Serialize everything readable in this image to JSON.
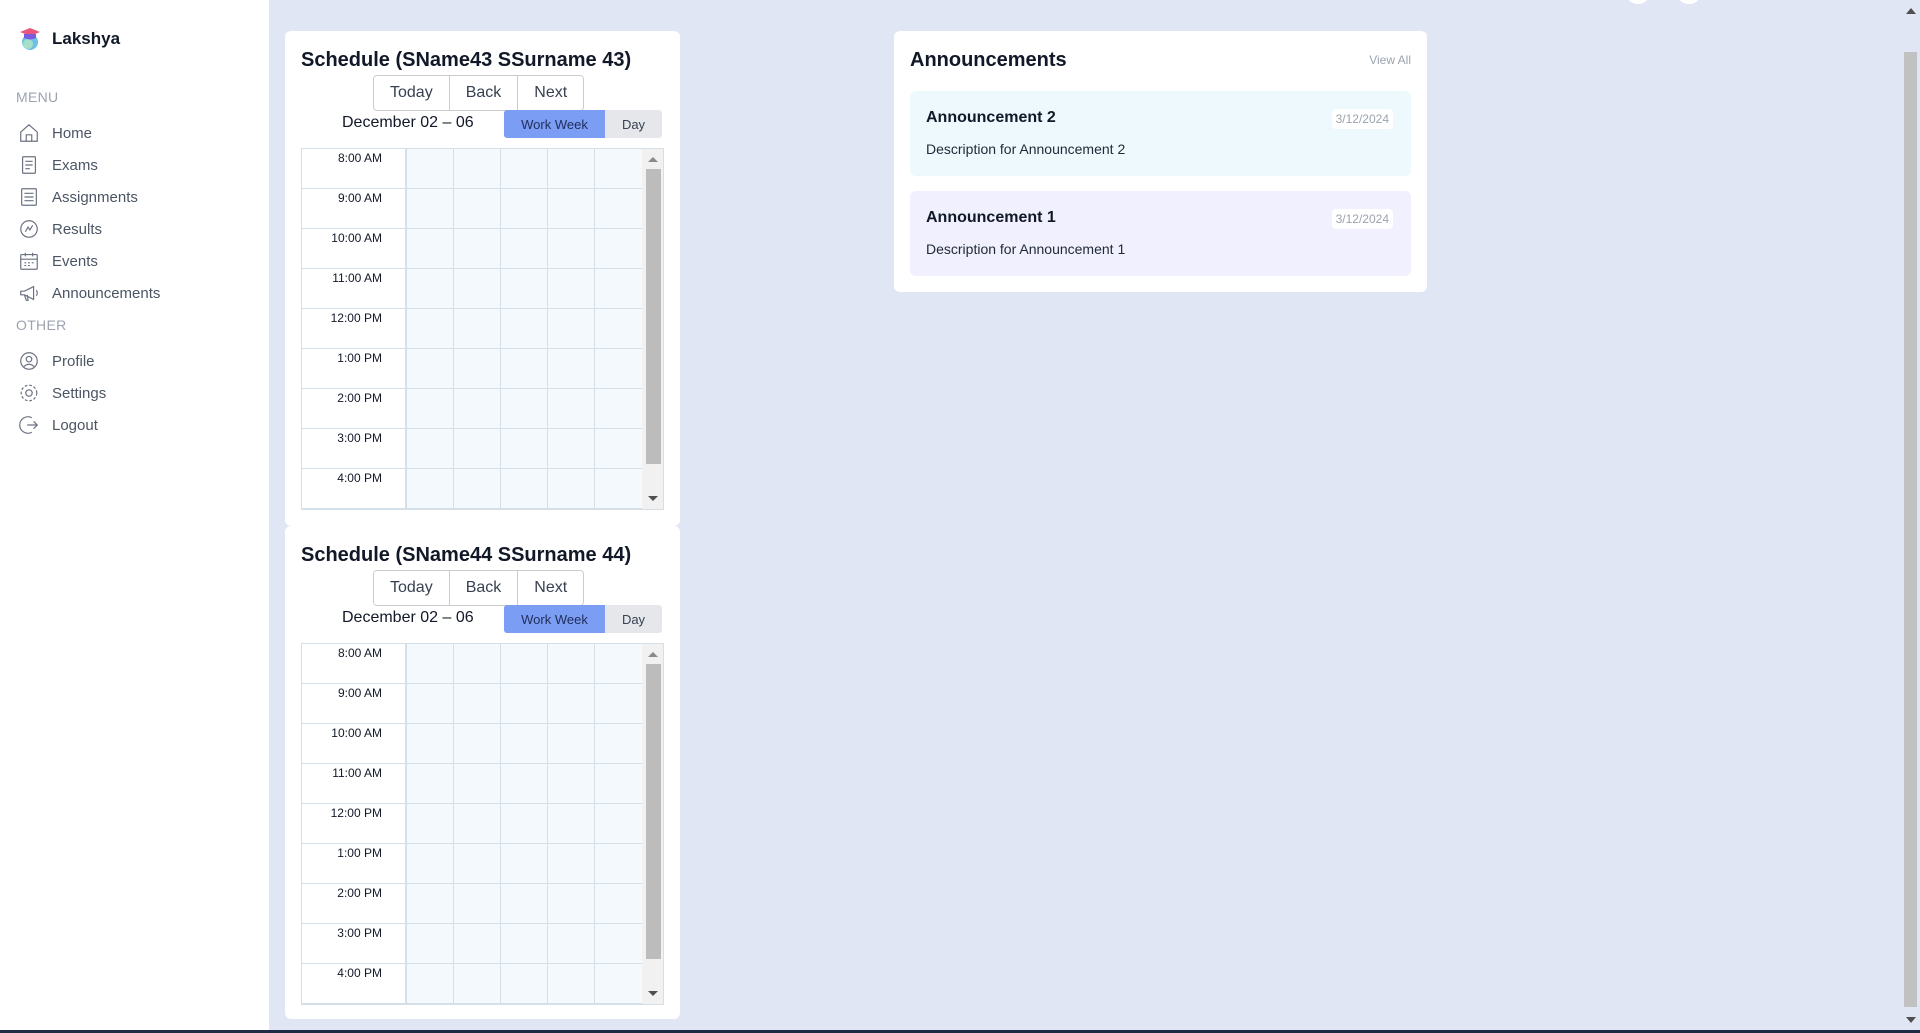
{
  "app": {
    "name": "Lakshya"
  },
  "sidebar": {
    "menu_label": "MENU",
    "menu_items": [
      {
        "label": "Home",
        "icon": "home-icon"
      },
      {
        "label": "Exams",
        "icon": "exam-icon"
      },
      {
        "label": "Assignments",
        "icon": "assignment-icon"
      },
      {
        "label": "Results",
        "icon": "result-icon"
      },
      {
        "label": "Events",
        "icon": "calendar-icon"
      },
      {
        "label": "Announcements",
        "icon": "megaphone-icon"
      }
    ],
    "other_label": "OTHER",
    "other_items": [
      {
        "label": "Profile",
        "icon": "profile-icon"
      },
      {
        "label": "Settings",
        "icon": "settings-icon"
      },
      {
        "label": "Logout",
        "icon": "logout-icon"
      }
    ]
  },
  "schedules": [
    {
      "title": "Schedule (SName43 SSurname 43)",
      "nav": {
        "today": "Today",
        "back": "Back",
        "next": "Next"
      },
      "range": "December 02 – 06",
      "views": {
        "work_week": "Work Week",
        "day": "Day",
        "active": "Work Week"
      },
      "times": [
        "8:00 AM",
        "9:00 AM",
        "10:00 AM",
        "11:00 AM",
        "12:00 PM",
        "1:00 PM",
        "2:00 PM",
        "3:00 PM",
        "4:00 PM"
      ]
    },
    {
      "title": "Schedule (SName44 SSurname 44)",
      "nav": {
        "today": "Today",
        "back": "Back",
        "next": "Next"
      },
      "range": "December 02 – 06",
      "views": {
        "work_week": "Work Week",
        "day": "Day",
        "active": "Work Week"
      },
      "times": [
        "8:00 AM",
        "9:00 AM",
        "10:00 AM",
        "11:00 AM",
        "12:00 PM",
        "1:00 PM",
        "2:00 PM",
        "3:00 PM",
        "4:00 PM"
      ]
    }
  ],
  "announcements": {
    "title": "Announcements",
    "view_all": "View All",
    "items": [
      {
        "name": "Announcement 2",
        "description": "Description for Announcement 2",
        "date": "3/12/2024",
        "bg": "#edf9fd"
      },
      {
        "name": "Announcement 1",
        "description": "Description for Announcement 1",
        "date": "3/12/2024",
        "bg": "#f1f0fe"
      }
    ]
  },
  "colors": {
    "page_bg": "#e1e6f5",
    "accent": "#7b9df3",
    "sky_light": "#edf9fd",
    "purple_light": "#f1f0fe"
  }
}
